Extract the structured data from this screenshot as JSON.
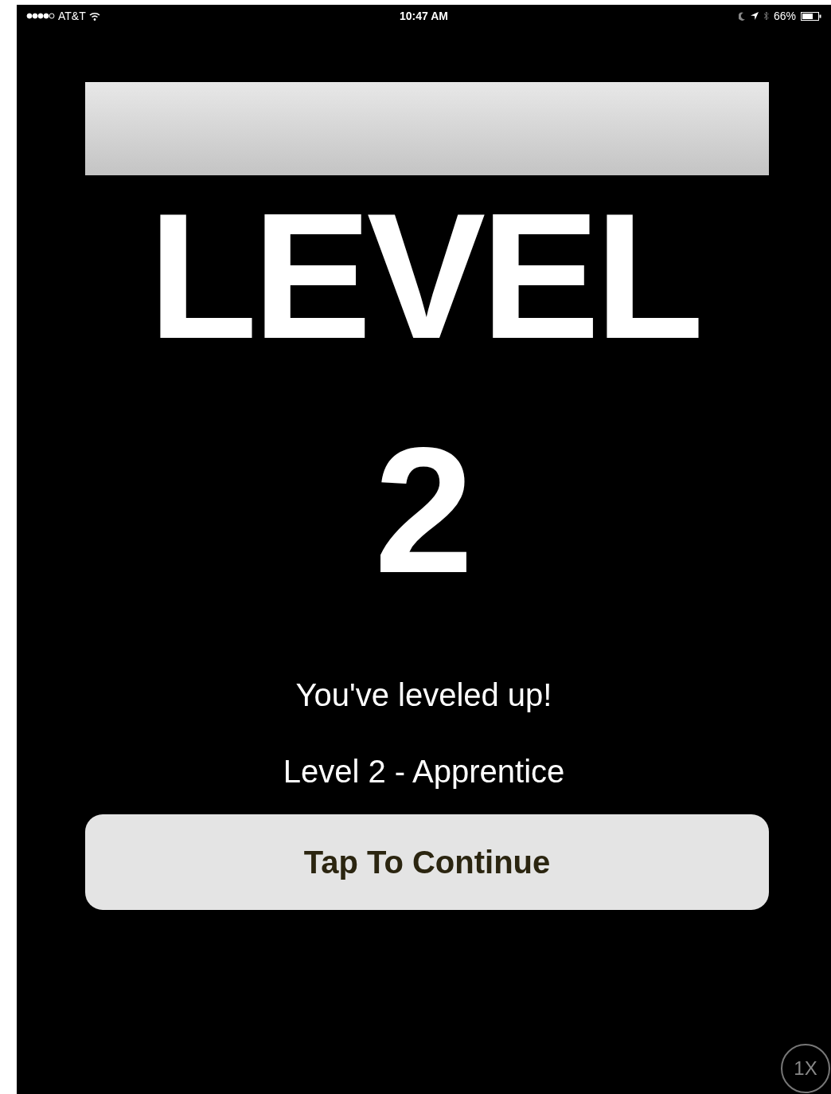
{
  "status_bar": {
    "carrier": "AT&T",
    "time": "10:47 AM",
    "battery": "66%"
  },
  "title": "LEVEL",
  "level_number": "2",
  "message": "You've leveled up!",
  "level_name": "Level 2 - Apprentice",
  "continue_button": "Tap To Continue",
  "speed_badge": "1X"
}
